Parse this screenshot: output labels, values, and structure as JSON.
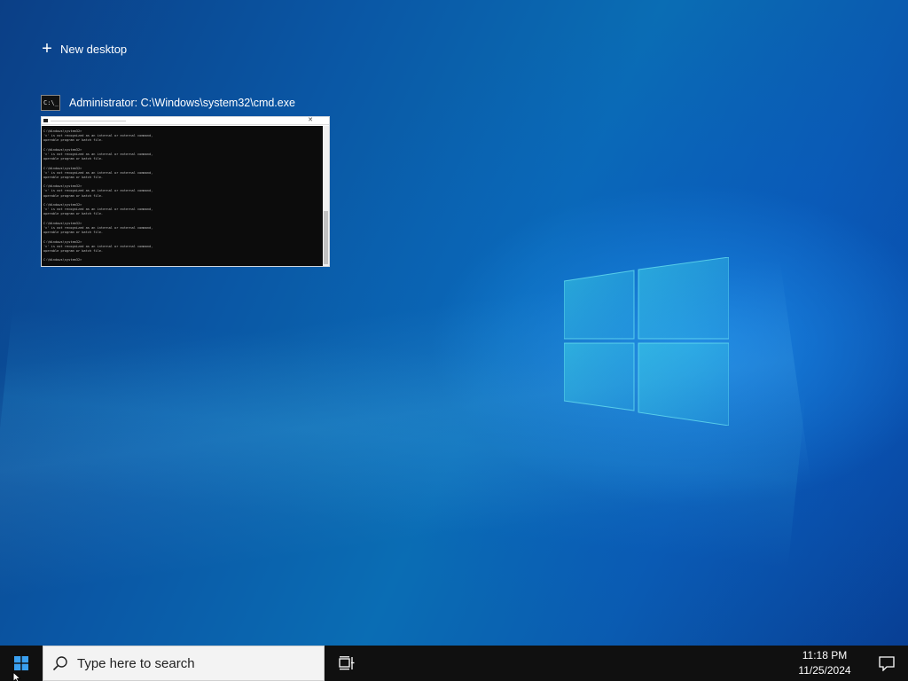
{
  "task_view": {
    "new_desktop_label": "New desktop",
    "windows": [
      {
        "title": "Administrator: C:\\Windows\\system32\\cmd.exe",
        "icon": "cmd-icon",
        "console_lines": [
          "C:\\Windows\\system32>",
          "'c' is not recognized as an internal or external command,",
          "operable program or batch file.",
          "",
          "C:\\Windows\\system32>",
          "'c' is not recognized as an internal or external command,",
          "operable program or batch file.",
          "",
          "C:\\Windows\\system32>",
          "'c' is not recognized as an internal or external command,",
          "operable program or batch file.",
          "",
          "C:\\Windows\\system32>",
          "'c' is not recognized as an internal or external command,",
          "operable program or batch file.",
          "",
          "C:\\Windows\\system32>",
          "'c' is not recognized as an internal or external command,",
          "operable program or batch file.",
          "",
          "C:\\Windows\\system32>",
          "'c' is not recognized as an internal or external command,",
          "operable program or batch file.",
          "",
          "C:\\Windows\\system32>",
          "'c' is not recognized as an internal or external command,",
          "operable program or batch file.",
          "",
          "C:\\Windows\\system32>"
        ]
      }
    ]
  },
  "taskbar": {
    "search_placeholder": "Type here to search",
    "time": "11:18 PM",
    "date": "11/25/2024"
  },
  "colors": {
    "taskbar": "#101010",
    "search_bg": "#f3f3f3",
    "accent": "#0a5fa6"
  }
}
